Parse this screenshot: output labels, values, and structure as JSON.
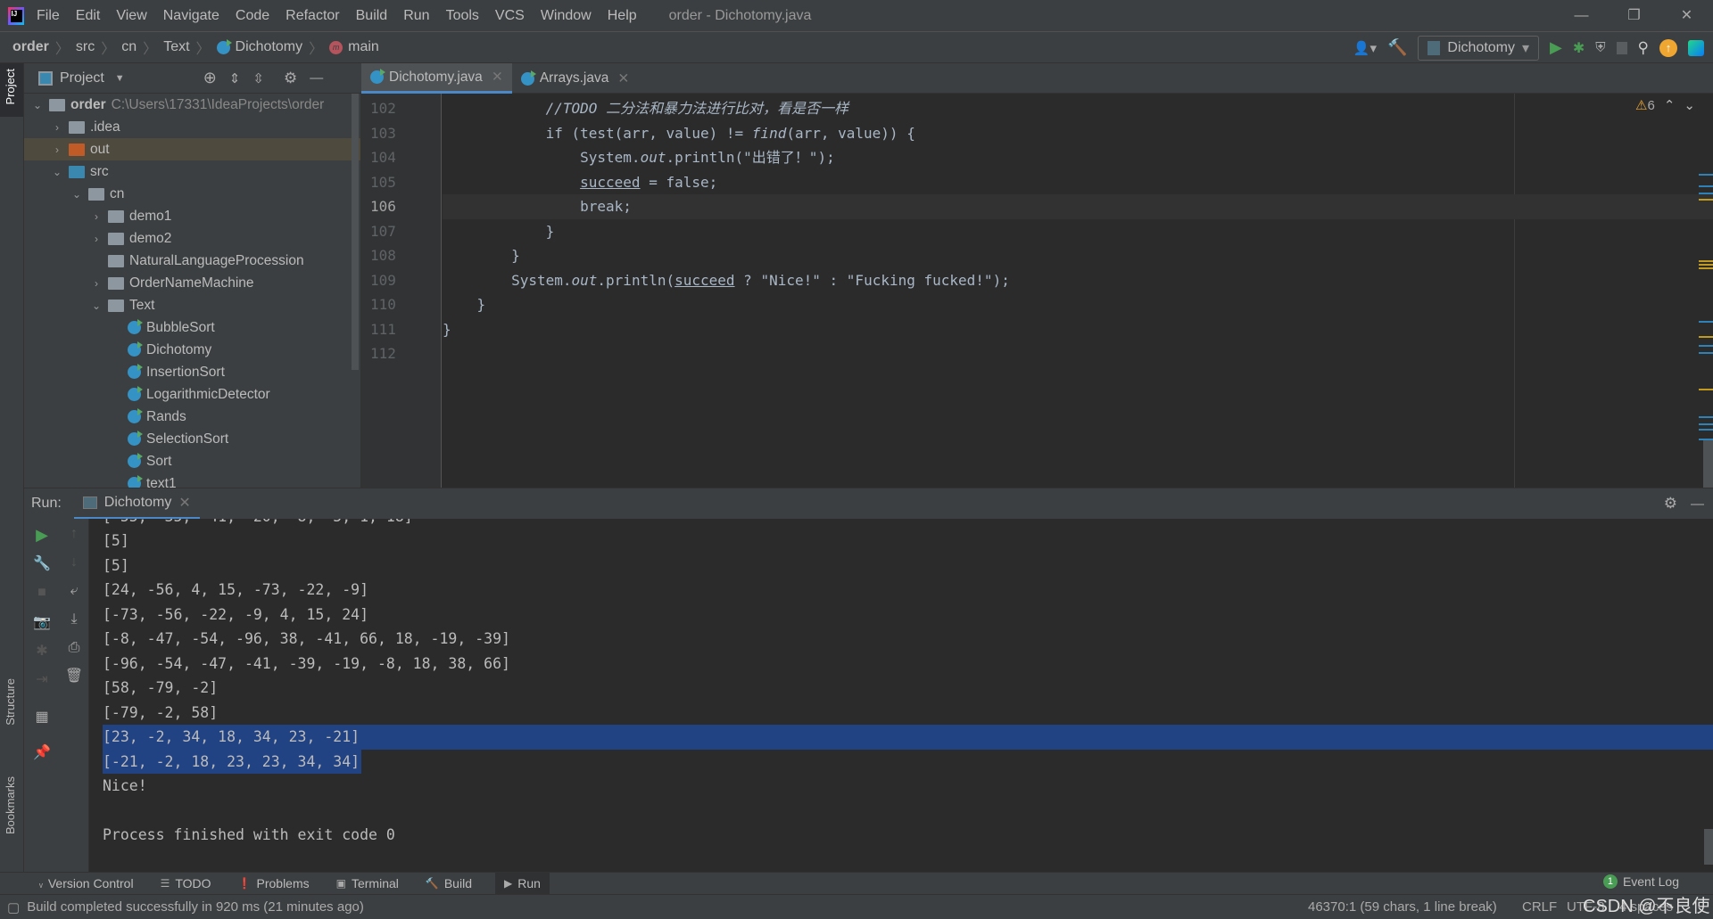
{
  "menubar": {
    "items": [
      "File",
      "Edit",
      "View",
      "Navigate",
      "Code",
      "Refactor",
      "Build",
      "Run",
      "Tools",
      "VCS",
      "Window",
      "Help"
    ],
    "title": "order - Dichotomy.java"
  },
  "breadcrumb": [
    "order",
    "src",
    "cn",
    "Text",
    "Dichotomy",
    "main"
  ],
  "toolbar": {
    "run_config": "Dichotomy"
  },
  "project": {
    "header": "Project",
    "root": "order",
    "root_path": "C:\\Users\\17331\\IdeaProjects\\order",
    "items": [
      {
        "label": ".idea",
        "type": "folder",
        "level": 1,
        "arrow": "›"
      },
      {
        "label": "out",
        "type": "out",
        "level": 1,
        "arrow": "›",
        "selected": true
      },
      {
        "label": "src",
        "type": "src",
        "level": 1,
        "arrow": "⌄"
      },
      {
        "label": "cn",
        "type": "package",
        "level": 2,
        "arrow": "⌄"
      },
      {
        "label": "demo1",
        "type": "package",
        "level": 3,
        "arrow": "›"
      },
      {
        "label": "demo2",
        "type": "package",
        "level": 3,
        "arrow": "›"
      },
      {
        "label": "NaturalLanguageProcession",
        "type": "package",
        "level": 3,
        "arrow": ""
      },
      {
        "label": "OrderNameMachine",
        "type": "package",
        "level": 3,
        "arrow": "›"
      },
      {
        "label": "Text",
        "type": "package",
        "level": 3,
        "arrow": "⌄"
      },
      {
        "label": "BubbleSort",
        "type": "class",
        "level": 4
      },
      {
        "label": "Dichotomy",
        "type": "class",
        "level": 4
      },
      {
        "label": "InsertionSort",
        "type": "class",
        "level": 4
      },
      {
        "label": "LogarithmicDetector",
        "type": "class",
        "level": 4
      },
      {
        "label": "Rands",
        "type": "class",
        "level": 4
      },
      {
        "label": "SelectionSort",
        "type": "class",
        "level": 4
      },
      {
        "label": "Sort",
        "type": "class",
        "level": 4
      },
      {
        "label": "text1",
        "type": "class",
        "level": 4
      }
    ]
  },
  "tabs": [
    {
      "label": "Dichotomy.java",
      "active": true
    },
    {
      "label": "Arrays.java",
      "active": false
    }
  ],
  "editor": {
    "warnings": "6",
    "current_line": 106,
    "lines": [
      {
        "n": 102,
        "tokens": [
          [
            "            ",
            "d"
          ],
          [
            "//",
            "c"
          ],
          [
            "TODO 二分法和暴力法进行比对，看是否一样",
            "td"
          ]
        ]
      },
      {
        "n": 103,
        "tokens": [
          [
            "            ",
            "d"
          ],
          [
            "if ",
            "k"
          ],
          [
            "(test(arr",
            "d"
          ],
          [
            ", ",
            "k"
          ],
          [
            "value) != ",
            "d"
          ],
          [
            "find",
            "i"
          ],
          [
            "(arr",
            "d"
          ],
          [
            ", ",
            "k"
          ],
          [
            "value)) {",
            "d"
          ]
        ]
      },
      {
        "n": 104,
        "tokens": [
          [
            "                System.",
            "d"
          ],
          [
            "out",
            "f"
          ],
          [
            ".println(",
            "d"
          ],
          [
            "\"出错了！\"",
            "s"
          ],
          [
            ")",
            "d"
          ],
          [
            ";",
            "k"
          ]
        ]
      },
      {
        "n": 105,
        "tokens": [
          [
            "                ",
            "d"
          ],
          [
            "succeed",
            "u"
          ],
          [
            " = ",
            "d"
          ],
          [
            "false;",
            "k"
          ]
        ]
      },
      {
        "n": 106,
        "tokens": [
          [
            "                ",
            "d"
          ],
          [
            "break;",
            "k"
          ]
        ]
      },
      {
        "n": 107,
        "tokens": [
          [
            "            }",
            "d"
          ]
        ]
      },
      {
        "n": 108,
        "tokens": [
          [
            "        }",
            "d"
          ]
        ]
      },
      {
        "n": 109,
        "tokens": [
          [
            "        System.",
            "d"
          ],
          [
            "out",
            "f"
          ],
          [
            ".println(",
            "d"
          ],
          [
            "succeed",
            "u"
          ],
          [
            " ? ",
            "d"
          ],
          [
            "\"Nice!\"",
            "s"
          ],
          [
            " : ",
            "d"
          ],
          [
            "\"Fucking fucked!\"",
            "s"
          ],
          [
            ")",
            "d"
          ],
          [
            ";",
            "k"
          ]
        ]
      },
      {
        "n": 110,
        "tokens": [
          [
            "    }",
            "d"
          ]
        ]
      },
      {
        "n": 111,
        "tokens": [
          [
            "}",
            "d"
          ]
        ]
      },
      {
        "n": 112,
        "tokens": []
      }
    ]
  },
  "run": {
    "label": "Run:",
    "tab": "Dichotomy",
    "lines": [
      "[5]",
      "[5]",
      "[24, -56, 4, 15, -73, -22, -9]",
      "[-73, -56, -22, -9, 4, 15, 24]",
      "[-8, -47, -54, -96, 38, -41, 66, 18, -19, -39]",
      "[-96, -54, -47, -41, -39, -19, -8, 18, 38, 66]",
      "[58, -79, -2]",
      "[-79, -2, 58]",
      "[23, -2, 34, 18, 34, 23, -21]",
      "[-21, -2, 18, 23, 23, 34, 34]",
      "Nice!",
      "",
      "Process finished with exit code 0"
    ],
    "selected_lines": [
      8,
      9
    ]
  },
  "side_labels": {
    "project": "Project",
    "structure": "Structure",
    "bookmarks": "Bookmarks"
  },
  "bottom_tabs": [
    "Version Control",
    "TODO",
    "Problems",
    "Terminal",
    "Build",
    "Run"
  ],
  "event_log": {
    "label": "Event Log",
    "count": "1"
  },
  "status": {
    "message": "Build completed successfully in 920 ms (21 minutes ago)",
    "position": "46370:1 (59 chars, 1 line break)",
    "line_sep": "CRLF",
    "encoding": "UTF-8",
    "indent": "4 spaces"
  },
  "watermark": "CSDN @不良使"
}
